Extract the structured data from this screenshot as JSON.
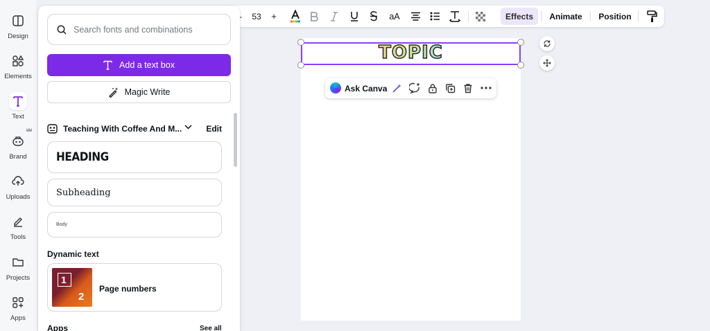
{
  "rail": {
    "items": [
      {
        "label": "Design",
        "icon": "design-icon"
      },
      {
        "label": "Elements",
        "icon": "elements-icon"
      },
      {
        "label": "Text",
        "icon": "text-icon"
      },
      {
        "label": "Brand",
        "icon": "brand-icon"
      },
      {
        "label": "Uploads",
        "icon": "uploads-icon"
      },
      {
        "label": "Tools",
        "icon": "tools-icon"
      },
      {
        "label": "Projects",
        "icon": "projects-icon"
      },
      {
        "label": "Apps",
        "icon": "apps-icon"
      }
    ],
    "active": "Text"
  },
  "panel": {
    "search_placeholder": "Search fonts and combinations",
    "add_text_box": "Add a text box",
    "magic_write": "Magic Write",
    "brand_kit": {
      "title": "Teaching With Coffee And M...",
      "edit": "Edit"
    },
    "styles": {
      "heading": "HEADING",
      "subheading": "Subheading",
      "body": "Body"
    },
    "dynamic_text": {
      "title": "Dynamic text",
      "item_label": "Page numbers",
      "thumb_numbers": [
        "1",
        "2"
      ]
    },
    "apps": {
      "title": "Apps",
      "see_all": "See all"
    }
  },
  "toolbar": {
    "font_size": "53",
    "decrease": "-",
    "increase": "+",
    "case_label": "aA",
    "effects": "Effects",
    "animate": "Animate",
    "position": "Position"
  },
  "canvas": {
    "text": "TOPIC",
    "ask_canva": "Ask Canva"
  },
  "colors": {
    "accent": "#7d2ae8",
    "selection": "#8b3dff"
  }
}
